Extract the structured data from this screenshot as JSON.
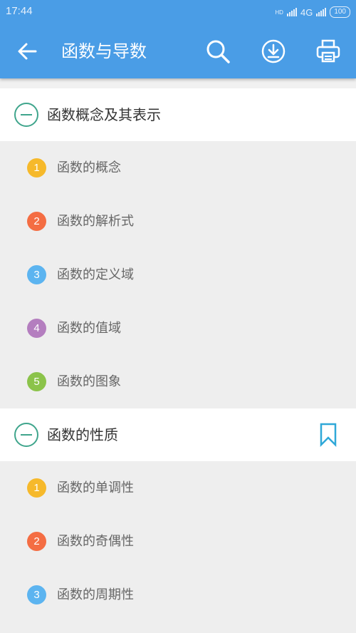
{
  "status_bar": {
    "time": "17:44",
    "network": "4G",
    "hd": "HD",
    "battery": "100"
  },
  "app_bar": {
    "title": "函数与导数"
  },
  "colors": {
    "primary": "#4a9de6",
    "accent": "#3fa58c",
    "bookmark": "#2fa8d8"
  },
  "sections": [
    {
      "title": "函数概念及其表示",
      "items": [
        {
          "num": "1",
          "label": "函数的概念",
          "color": "#f6b92b"
        },
        {
          "num": "2",
          "label": "函数的解析式",
          "color": "#f46d43"
        },
        {
          "num": "3",
          "label": "函数的定义域",
          "color": "#5cb4f0"
        },
        {
          "num": "4",
          "label": "函数的值域",
          "color": "#b47ebf"
        },
        {
          "num": "5",
          "label": "函数的图象",
          "color": "#8bc34a"
        }
      ]
    },
    {
      "title": "函数的性质",
      "items": [
        {
          "num": "1",
          "label": "函数的单调性",
          "color": "#f6b92b"
        },
        {
          "num": "2",
          "label": "函数的奇偶性",
          "color": "#f46d43"
        },
        {
          "num": "3",
          "label": "函数的周期性",
          "color": "#5cb4f0"
        }
      ]
    }
  ]
}
